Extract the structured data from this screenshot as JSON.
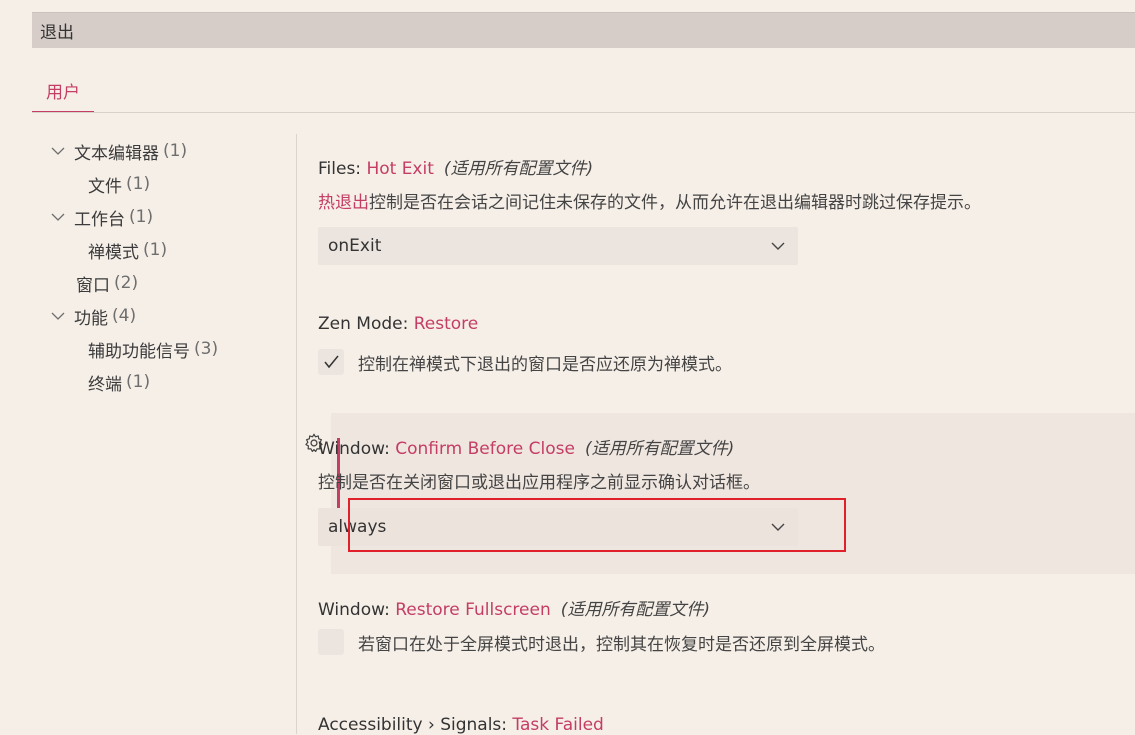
{
  "search": {
    "value": "退出"
  },
  "tabs": [
    {
      "label": "用户"
    }
  ],
  "toc": [
    {
      "label": "文本编辑器",
      "count": "(1)",
      "expandable": true
    },
    {
      "label": "文件",
      "count": "(1)"
    },
    {
      "label": "工作台",
      "count": "(1)",
      "expandable": true
    },
    {
      "label": "禅模式",
      "count": "(1)"
    },
    {
      "label": "窗口",
      "count": "(2)"
    },
    {
      "label": "功能",
      "count": "(4)",
      "expandable": true
    },
    {
      "label": "辅助功能信号",
      "count": "(3)"
    },
    {
      "label": "终端",
      "count": "(1)"
    }
  ],
  "settings": {
    "hot_exit": {
      "category": "Files: ",
      "key": "Hot Exit",
      "scope": "(适用所有配置文件)",
      "desc_link": "热退出",
      "desc_rest": "控制是否在会话之间记住未保存的文件，从而允许在退出编辑器时跳过保存提示。",
      "value": "onExit"
    },
    "zen_restore": {
      "category": "Zen Mode: ",
      "key": "Restore",
      "label": "控制在禅模式下退出的窗口是否应还原为禅模式。",
      "checked": true
    },
    "confirm_close": {
      "category": "Window: ",
      "key": "Confirm Before Close",
      "scope": "(适用所有配置文件)",
      "desc": "控制是否在关闭窗口或退出应用程序之前显示确认对话框。",
      "value": "always"
    },
    "restore_fullscreen": {
      "category": "Window: ",
      "key": "Restore Fullscreen",
      "scope": "(适用所有配置文件)",
      "label": "若窗口在处于全屏模式时退出，控制其在恢复时是否还原到全屏模式。",
      "checked": false
    },
    "task_failed": {
      "category": "Accessibility › Signals: ",
      "key": "Task Failed"
    }
  },
  "colors": {
    "accent": "#c43d64",
    "highlight": "#e0202a",
    "background": "#f6efe8"
  }
}
